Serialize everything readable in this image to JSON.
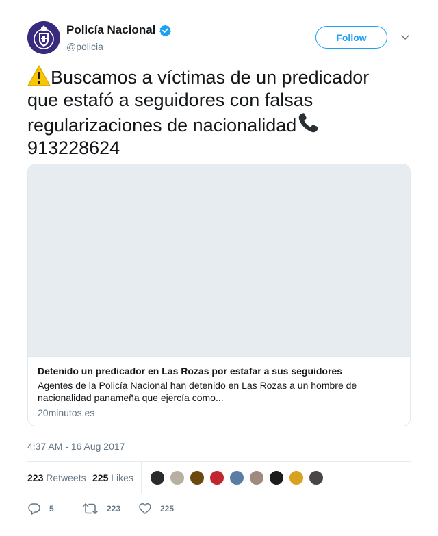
{
  "author": {
    "display_name": "Policía Nacional",
    "handle": "@policia",
    "verified": true,
    "avatar_icon": "police-shield-logo",
    "avatar_color": "#3a2a7e"
  },
  "follow_label": "Follow",
  "tweet": {
    "lines": [
      "Buscamos a víctimas de un predicador",
      "que estafó a seguidores con falsas",
      "regularizaciones de nacionalidad",
      "913228624"
    ],
    "leading_emoji": "warning-icon",
    "trailing_emoji": "telephone-icon"
  },
  "card": {
    "title": "Detenido un predicador en Las Rozas por estafar a sus seguidores",
    "description": "Agentes de la Policía Nacional han detenido en Las Rozas a un hombre de nacionalidad panameña que ejercía como...",
    "domain": "20minutos.es"
  },
  "timestamp": "4:37 AM - 16 Aug 2017",
  "stats": {
    "retweets_count": "223",
    "retweets_label": "Retweets",
    "likes_count": "225",
    "likes_label": "Likes"
  },
  "likers": [
    {
      "name": "liker-avatar-1",
      "color": "#2b2b2b"
    },
    {
      "name": "liker-avatar-2",
      "color": "#b8b0a0"
    },
    {
      "name": "liker-avatar-3",
      "color": "#6b4a10"
    },
    {
      "name": "liker-avatar-4",
      "color": "#c0282d"
    },
    {
      "name": "liker-avatar-5",
      "color": "#5a7da8"
    },
    {
      "name": "liker-avatar-6",
      "color": "#a08a80"
    },
    {
      "name": "liker-avatar-7",
      "color": "#1c1c1c"
    },
    {
      "name": "liker-avatar-8",
      "color": "#d9a21e"
    },
    {
      "name": "liker-avatar-9",
      "color": "#4a4548"
    }
  ],
  "actions": {
    "replies": "5",
    "retweets": "223",
    "likes": "225"
  },
  "colors": {
    "accent": "#1da1f2",
    "text": "#14171a",
    "muted": "#657786",
    "border": "#e1e8ed"
  }
}
